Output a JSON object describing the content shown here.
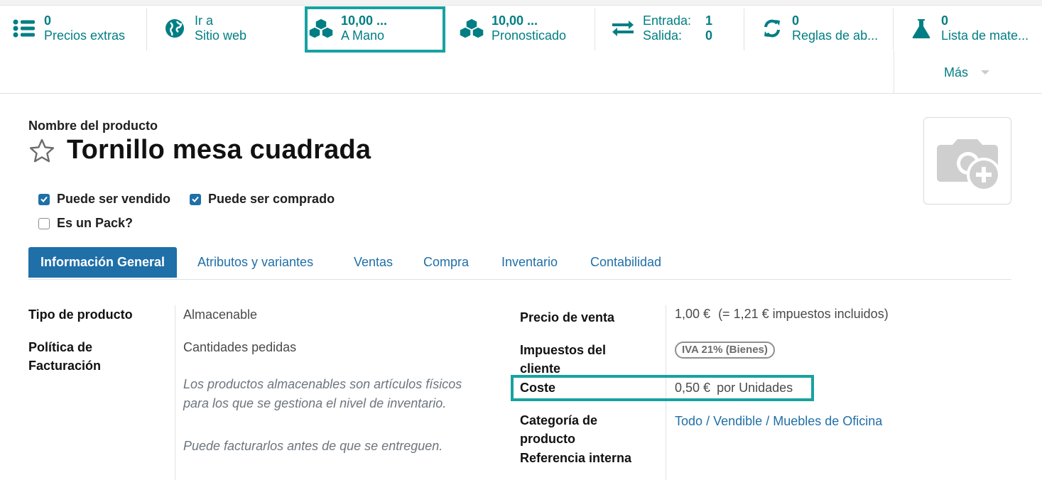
{
  "smart_buttons": {
    "extra_prices": {
      "value": "0",
      "label": "Precios extras",
      "icon": "list-icon"
    },
    "website": {
      "value": "Ir a",
      "label": "Sitio web",
      "icon": "globe-icon"
    },
    "on_hand": {
      "value": "10,00 ...",
      "label": "A Mano",
      "icon": "cubes-icon"
    },
    "forecasted": {
      "value": "10,00 ...",
      "label": "Pronosticado",
      "icon": "cubes-icon"
    },
    "in_out": {
      "in_label": "Entrada:",
      "in_value": "1",
      "out_label": "Salida:",
      "out_value": "0",
      "icon": "exchange-icon"
    },
    "reorder": {
      "value": "0",
      "label": "Reglas de ab...",
      "icon": "refresh-icon"
    },
    "bom": {
      "value": "0",
      "label": "Lista de mate...",
      "icon": "flask-icon"
    },
    "more": {
      "label": "Más"
    }
  },
  "header": {
    "name_label": "Nombre del producto",
    "title": "Tornillo mesa cuadrada"
  },
  "options": {
    "can_be_sold": {
      "label": "Puede ser vendido",
      "checked": true
    },
    "can_be_purchased": {
      "label": "Puede ser comprado",
      "checked": true
    },
    "is_pack": {
      "label": "Es un Pack?",
      "checked": false
    }
  },
  "tabs": [
    {
      "label": "Información General",
      "active": true
    },
    {
      "label": "Atributos y variantes"
    },
    {
      "label": "Ventas"
    },
    {
      "label": "Compra"
    },
    {
      "label": "Inventario"
    },
    {
      "label": "Contabilidad"
    }
  ],
  "left_fields": {
    "product_type": {
      "label": "Tipo de producto",
      "value": "Almacenable"
    },
    "invoice_policy": {
      "label_line1": "Política de",
      "label_line2": "Facturación",
      "value": "Cantidades pedidas"
    },
    "help1": "Los productos almacenables son artículos físicos para los que se gestiona el nivel de inventario.",
    "help2": "Puede facturarlos antes de que se entreguen."
  },
  "right_fields": {
    "sale_price": {
      "label": "Precio de venta",
      "value": "1,00 €",
      "tax_included": "(= 1,21 € impuestos incluidos)"
    },
    "customer_taxes": {
      "label_line1": "Impuestos del",
      "label_line2": "cliente",
      "badge": "IVA 21% (Bienes)"
    },
    "cost": {
      "label": "Coste",
      "value": "0,50 €",
      "unit": "por Unidades"
    },
    "category": {
      "label_line1": "Categoría de",
      "label_line2": "producto",
      "path": [
        "Todo",
        "Vendible",
        "Muebles de Oficina"
      ],
      "separator": "/"
    },
    "internal_ref": {
      "label": "Referencia interna"
    }
  },
  "colors": {
    "accent": "#017e84",
    "primary": "#1f6fa8",
    "highlight": "#17a2a1"
  }
}
